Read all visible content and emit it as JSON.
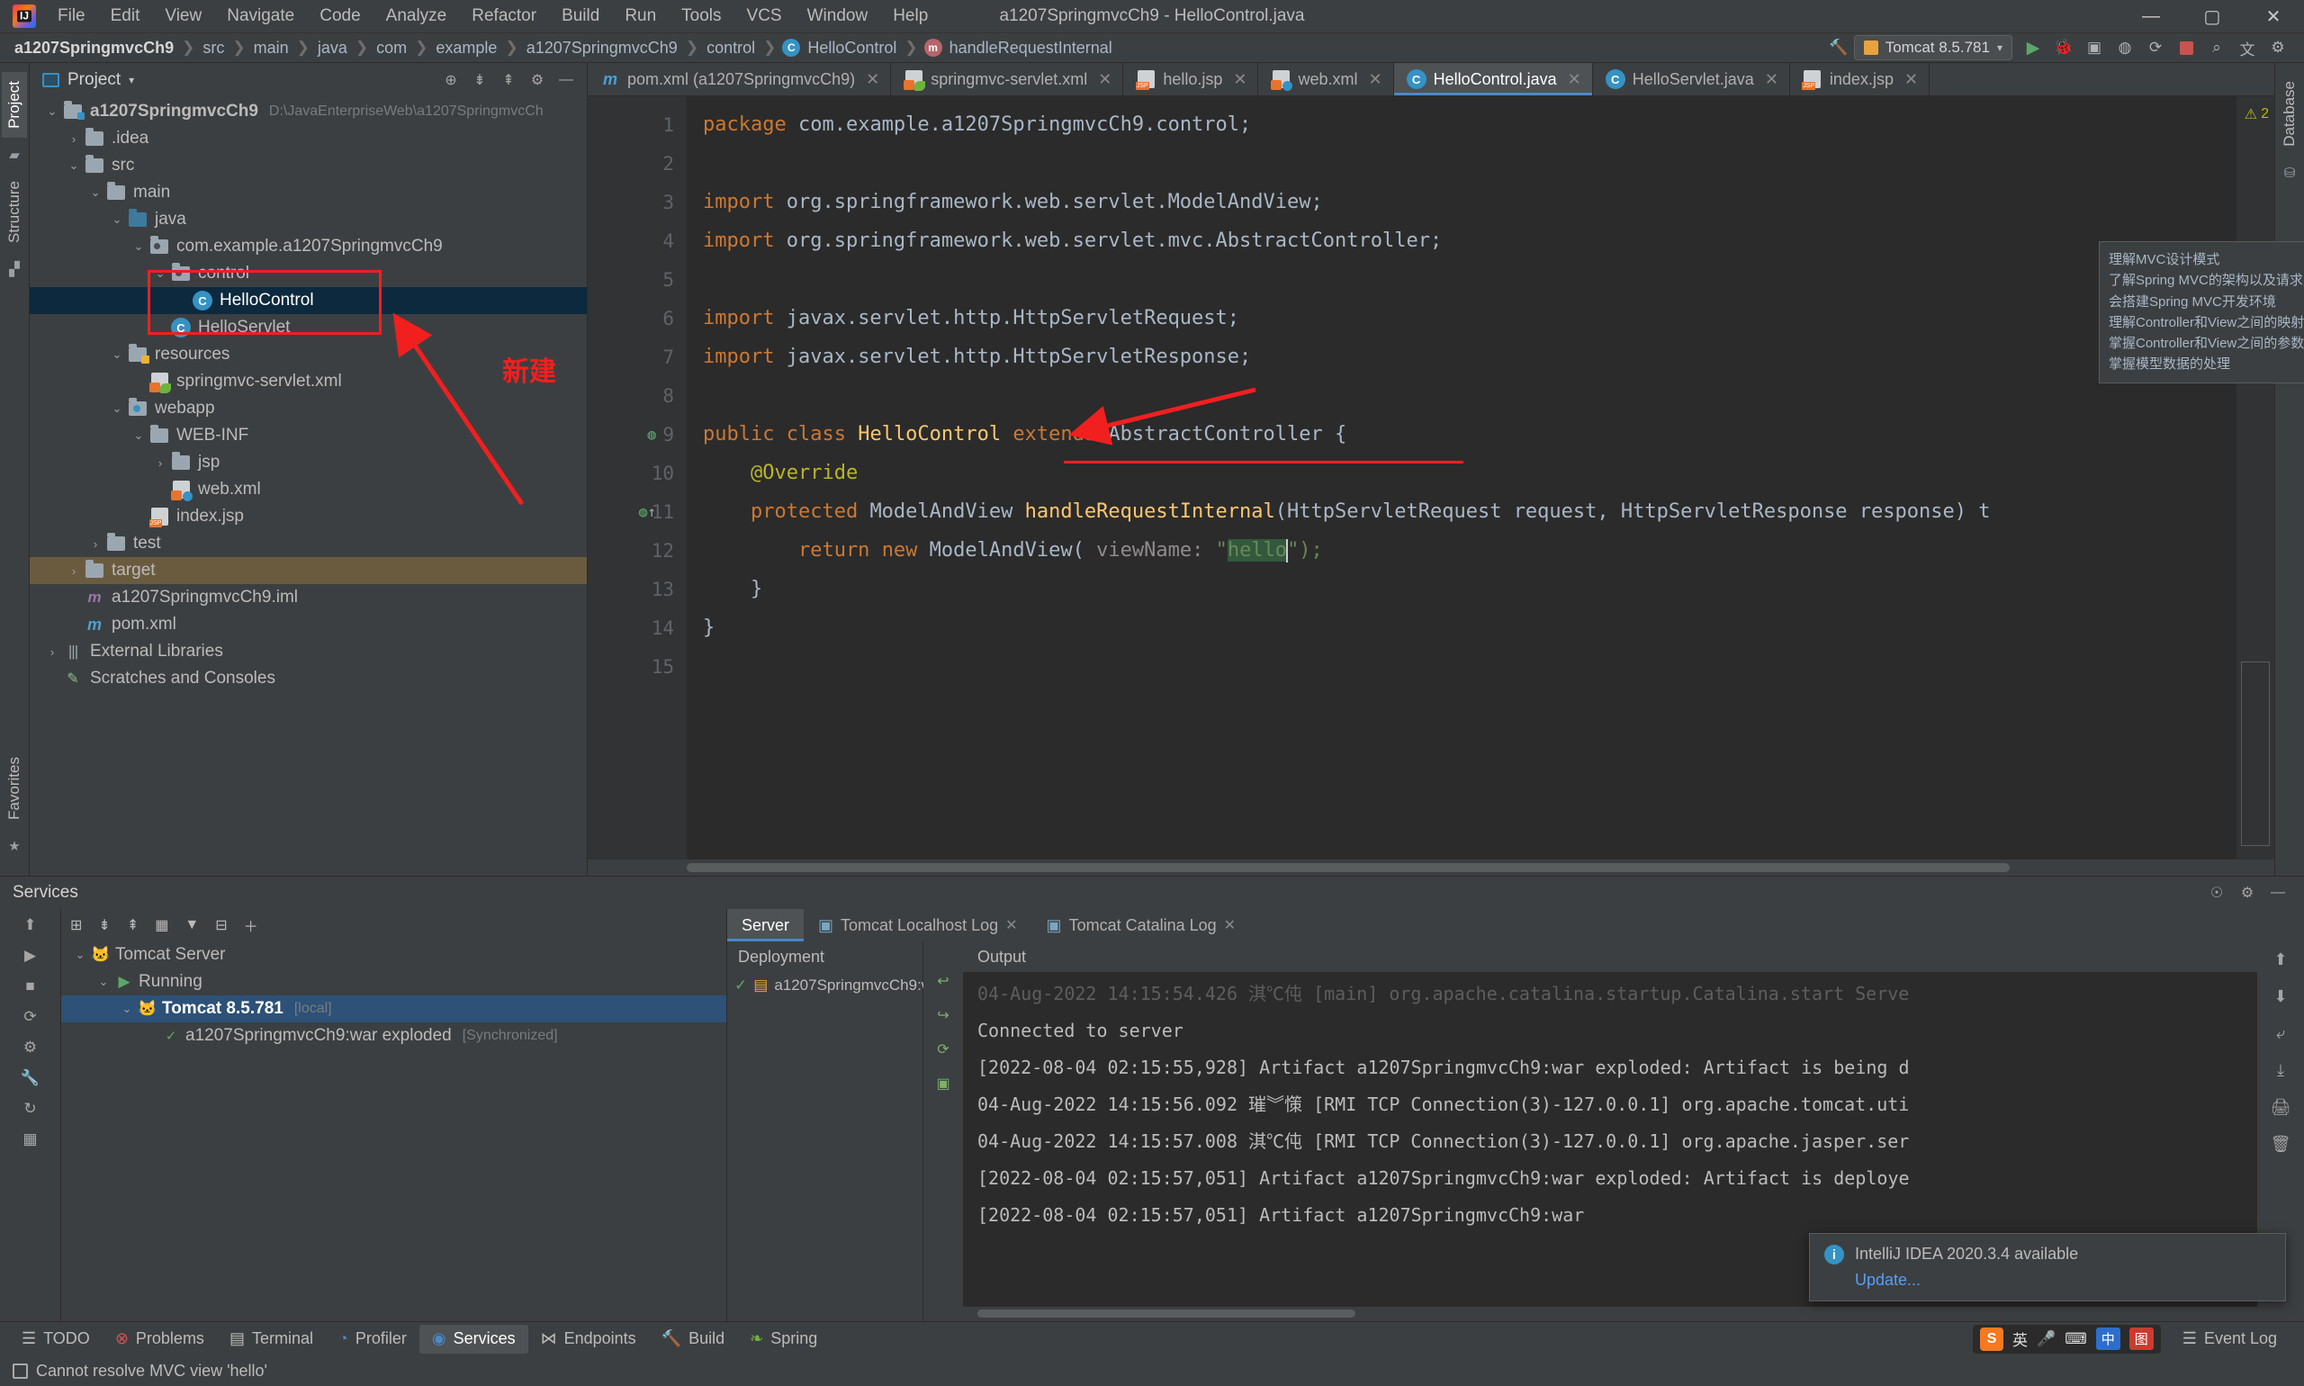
{
  "window": {
    "title": "a1207SpringmvcCh9 - HelloControl.java",
    "minimize": "—",
    "maximize": "▢",
    "close": "✕"
  },
  "menu": [
    "File",
    "Edit",
    "View",
    "Navigate",
    "Code",
    "Analyze",
    "Refactor",
    "Build",
    "Run",
    "Tools",
    "VCS",
    "Window",
    "Help"
  ],
  "breadcrumb": [
    {
      "label": "a1207SpringmvcCh9",
      "bold": true,
      "icon": ""
    },
    {
      "label": "src",
      "bold": false,
      "icon": ""
    },
    {
      "label": "main",
      "bold": false,
      "icon": ""
    },
    {
      "label": "java",
      "bold": false,
      "icon": ""
    },
    {
      "label": "com",
      "bold": false,
      "icon": ""
    },
    {
      "label": "example",
      "bold": false,
      "icon": ""
    },
    {
      "label": "a1207SpringmvcCh9",
      "bold": false,
      "icon": ""
    },
    {
      "label": "control",
      "bold": false,
      "icon": ""
    },
    {
      "label": "HelloControl",
      "bold": false,
      "icon": "class-icon"
    },
    {
      "label": "handleRequestInternal",
      "bold": false,
      "icon": "method-icon"
    }
  ],
  "toolbar": {
    "run_config": "Tomcat 8.5.781",
    "search_icon": "🔍",
    "run_icon": "▶",
    "debug_icon": "🐞",
    "stop_icon": "■",
    "build_icon": "🔨",
    "settings_icon": "⚙",
    "translate_icon": "文",
    "dropdown_icon": "▾"
  },
  "left_rail": {
    "project_tab": "Project",
    "structure_tab": "Structure",
    "favorites_tab": "Favorites"
  },
  "right_rail": {
    "database_tab": "Database"
  },
  "project_panel": {
    "title": "Project",
    "tree": [
      {
        "indent": 0,
        "arrow": "v",
        "icon": "project-folder-icon",
        "label": "a1207SpringmvcCh9",
        "sub": "D:\\JavaEnterpriseWeb\\a1207SpringmvcCh",
        "bold": true
      },
      {
        "indent": 1,
        "arrow": ">",
        "icon": "folder-icon",
        "label": ".idea",
        "sub": "",
        "bold": false
      },
      {
        "indent": 1,
        "arrow": "v",
        "icon": "folder-icon",
        "label": "src",
        "sub": "",
        "bold": false
      },
      {
        "indent": 2,
        "arrow": "v",
        "icon": "folder-icon",
        "label": "main",
        "sub": "",
        "bold": false
      },
      {
        "indent": 3,
        "arrow": "v",
        "icon": "source-folder-icon",
        "label": "java",
        "sub": "",
        "bold": false
      },
      {
        "indent": 4,
        "arrow": "v",
        "icon": "package-icon",
        "label": "com.example.a1207SpringmvcCh9",
        "sub": "",
        "bold": false
      },
      {
        "indent": 5,
        "arrow": "v",
        "icon": "package-icon",
        "label": "control",
        "sub": "",
        "bold": false
      },
      {
        "indent": 6,
        "arrow": "",
        "icon": "class-icon",
        "label": "HelloControl",
        "sub": "",
        "bold": false,
        "selected": true
      },
      {
        "indent": 5,
        "arrow": "",
        "icon": "class-icon",
        "label": "HelloServlet",
        "sub": "",
        "bold": false
      },
      {
        "indent": 3,
        "arrow": "v",
        "icon": "resources-folder-icon",
        "label": "resources",
        "sub": "",
        "bold": false
      },
      {
        "indent": 4,
        "arrow": "",
        "icon": "spring-xml-icon",
        "label": "springmvc-servlet.xml",
        "sub": "",
        "bold": false
      },
      {
        "indent": 3,
        "arrow": "v",
        "icon": "web-folder-icon",
        "label": "webapp",
        "sub": "",
        "bold": false
      },
      {
        "indent": 4,
        "arrow": "v",
        "icon": "folder-icon",
        "label": "WEB-INF",
        "sub": "",
        "bold": false
      },
      {
        "indent": 5,
        "arrow": ">",
        "icon": "folder-icon",
        "label": "jsp",
        "sub": "",
        "bold": false
      },
      {
        "indent": 5,
        "arrow": "",
        "icon": "web-xml-icon",
        "label": "web.xml",
        "sub": "",
        "bold": false
      },
      {
        "indent": 4,
        "arrow": "",
        "icon": "jsp-icon",
        "label": "index.jsp",
        "sub": "",
        "bold": false
      },
      {
        "indent": 2,
        "arrow": ">",
        "icon": "folder-icon",
        "label": "test",
        "sub": "",
        "bold": false
      },
      {
        "indent": 1,
        "arrow": ">",
        "icon": "folder-icon",
        "label": "target",
        "sub": "",
        "bold": false,
        "target": true
      },
      {
        "indent": 1,
        "arrow": "",
        "icon": "iml-icon",
        "label": "a1207SpringmvcCh9.iml",
        "sub": "",
        "bold": false
      },
      {
        "indent": 1,
        "arrow": "",
        "icon": "maven-icon",
        "label": "pom.xml",
        "sub": "",
        "bold": false
      },
      {
        "indent": 0,
        "arrow": ">",
        "icon": "library-icon",
        "label": "External Libraries",
        "sub": "",
        "bold": false
      },
      {
        "indent": 0,
        "arrow": "",
        "icon": "scratches-icon",
        "label": "Scratches and Consoles",
        "sub": "",
        "bold": false
      }
    ],
    "annotation_label": "新建"
  },
  "editor": {
    "tabs": [
      {
        "label": "pom.xml (a1207SpringmvcCh9)",
        "icon": "maven-icon",
        "active": false
      },
      {
        "label": "springmvc-servlet.xml",
        "icon": "spring-xml-icon",
        "active": false
      },
      {
        "label": "hello.jsp",
        "icon": "jsp-icon",
        "active": false
      },
      {
        "label": "web.xml",
        "icon": "web-xml-icon",
        "active": false
      },
      {
        "label": "HelloControl.java",
        "icon": "class-icon",
        "active": true
      },
      {
        "label": "HelloServlet.java",
        "icon": "class-icon",
        "active": false
      },
      {
        "label": "index.jsp",
        "icon": "jsp-icon",
        "active": false
      }
    ],
    "warning_count": "2",
    "line_numbers": [
      "1",
      "2",
      "3",
      "4",
      "5",
      "6",
      "7",
      "8",
      "9",
      "10",
      "11",
      "12",
      "13",
      "14",
      "15"
    ],
    "code_lines": [
      {
        "n": 1,
        "tokens": [
          {
            "t": "package ",
            "c": "kw"
          },
          {
            "t": "com.example.a1207SpringmvcCh9.control;",
            "c": "plain"
          }
        ]
      },
      {
        "n": 2,
        "tokens": []
      },
      {
        "n": 3,
        "fold": "−",
        "tokens": [
          {
            "t": "import ",
            "c": "kw"
          },
          {
            "t": "org.springframework.web.servlet.ModelAndView;",
            "c": "plain"
          }
        ]
      },
      {
        "n": 4,
        "tokens": [
          {
            "t": "import ",
            "c": "kw"
          },
          {
            "t": "org.springframework.web.servlet.mvc.AbstractController;",
            "c": "plain"
          }
        ]
      },
      {
        "n": 5,
        "tokens": []
      },
      {
        "n": 6,
        "tokens": [
          {
            "t": "import ",
            "c": "kw"
          },
          {
            "t": "javax.servlet.http.HttpServletRequest;",
            "c": "plain"
          }
        ]
      },
      {
        "n": 7,
        "fold": "−",
        "tokens": [
          {
            "t": "import ",
            "c": "kw"
          },
          {
            "t": "javax.servlet.http.HttpServletResponse;",
            "c": "plain"
          }
        ]
      },
      {
        "n": 8,
        "tokens": []
      },
      {
        "n": 9,
        "tokens": [
          {
            "t": "public ",
            "c": "kw"
          },
          {
            "t": "class ",
            "c": "kw"
          },
          {
            "t": "HelloControl ",
            "c": "ident"
          },
          {
            "t": "extends ",
            "c": "kw"
          },
          {
            "t": "AbstractController ",
            "c": "plain"
          },
          {
            "t": "{",
            "c": "plain"
          }
        ]
      },
      {
        "n": 10,
        "tokens": [
          {
            "t": "    @Override",
            "c": "ann"
          }
        ]
      },
      {
        "n": 11,
        "tokens": [
          {
            "t": "    protected ",
            "c": "kw"
          },
          {
            "t": "ModelAndView ",
            "c": "plain"
          },
          {
            "t": "handleRequestInternal",
            "c": "ident"
          },
          {
            "t": "(HttpServletRequest ",
            "c": "plain"
          },
          {
            "t": "request",
            "c": "plain"
          },
          {
            "t": ", HttpServletResponse ",
            "c": "plain"
          },
          {
            "t": "response",
            "c": "plain"
          },
          {
            "t": ") t",
            "c": "plain"
          }
        ]
      },
      {
        "n": 12,
        "tokens": [
          {
            "t": "        return ",
            "c": "kw"
          },
          {
            "t": "new ",
            "c": "kw"
          },
          {
            "t": "ModelAndView( ",
            "c": "plain"
          },
          {
            "t": "viewName:",
            "c": "param"
          },
          {
            "t": " \"",
            "c": "str"
          },
          {
            "t": "hello",
            "c": "str-sel"
          },
          {
            "t": "\");",
            "c": "str"
          }
        ]
      },
      {
        "n": 13,
        "fold": "−",
        "tokens": [
          {
            "t": "    }",
            "c": "plain"
          }
        ]
      },
      {
        "n": 14,
        "tokens": [
          {
            "t": "}",
            "c": "plain"
          }
        ]
      },
      {
        "n": 15,
        "tokens": []
      }
    ],
    "help_overlay": [
      "理解MVC设计模式",
      "了解Spring MVC的架构以及请求处理流程",
      "会搭建Spring MVC开发环境",
      "理解Controller和View之间的映射关系",
      "掌握Controller和View之间的参数传递",
      "掌握模型数据的处理"
    ]
  },
  "services": {
    "title": "Services",
    "tree": [
      {
        "indent": 0,
        "arrow": "v",
        "icon": "tomcat-icon",
        "label": "Tomcat Server",
        "sub": "",
        "bold": false
      },
      {
        "indent": 1,
        "arrow": "v",
        "icon": "run-icon",
        "label": "Running",
        "sub": "",
        "bold": false
      },
      {
        "indent": 2,
        "arrow": "v",
        "icon": "tomcat-icon",
        "label": "Tomcat 8.5.781",
        "sub": "[local]",
        "bold": true,
        "selected": true
      },
      {
        "indent": 3,
        "arrow": "",
        "icon": "artifact-icon",
        "label": "a1207SpringmvcCh9:war exploded",
        "sub": "[Synchronized]",
        "bold": false
      }
    ],
    "console_tabs": [
      {
        "label": "Server",
        "active": true,
        "closable": false
      },
      {
        "label": "Tomcat Localhost Log",
        "active": false,
        "closable": true
      },
      {
        "label": "Tomcat Catalina Log",
        "active": false,
        "closable": true
      }
    ],
    "deployment_header": "Deployment",
    "deployment_rows": [
      {
        "label": "a1207SpringmvcCh9:w",
        "status": "ok"
      }
    ],
    "output_header": "Output",
    "output_lines": [
      "04-Aug-2022 14:15:54.426 淇℃伅 [main] org.apache.catalina.startup.Catalina.start Serve",
      "Connected to server",
      "[2022-08-04 02:15:55,928] Artifact a1207SpringmvcCh9:war exploded: Artifact is being d",
      "04-Aug-2022 14:15:56.092 璀︾憡 [RMI TCP Connection(3)-127.0.0.1] org.apache.tomcat.uti",
      "04-Aug-2022 14:15:57.008 淇℃伅 [RMI TCP Connection(3)-127.0.0.1] org.apache.jasper.ser",
      "[2022-08-04 02:15:57,051] Artifact a1207SpringmvcCh9:war exploded: Artifact is deploye",
      "[2022-08-04 02:15:57,051] Artifact a1207SpringmvcCh9:war"
    ]
  },
  "notification": {
    "title": "IntelliJ IDEA 2020.3.4 available",
    "link": "Update..."
  },
  "statusbar": {
    "items": [
      {
        "label": "TODO",
        "icon": "todo-icon",
        "active": false
      },
      {
        "label": "Problems",
        "icon": "problems-icon",
        "active": false
      },
      {
        "label": "Terminal",
        "icon": "terminal-icon",
        "active": false
      },
      {
        "label": "Profiler",
        "icon": "profiler-icon",
        "active": false
      },
      {
        "label": "Services",
        "icon": "services-icon",
        "active": true
      },
      {
        "label": "Endpoints",
        "icon": "endpoints-icon",
        "active": false
      },
      {
        "label": "Build",
        "icon": "build-icon",
        "active": false
      },
      {
        "label": "Spring",
        "icon": "spring-icon",
        "active": false
      }
    ],
    "event_log": "Event Log",
    "error_message": "Cannot resolve MVC view 'hello'",
    "ime": {
      "lang": "英",
      "mic": "🎤",
      "keyboard": "⌨",
      "logo": "S"
    }
  },
  "colors": {
    "accent": "#4a88c7",
    "annotation_red": "#f21f1f",
    "selection_blue": "#0d293e",
    "keyword_orange": "#cc7832",
    "string_green": "#6a8759",
    "panel_bg": "#3c3f41",
    "editor_bg": "#2b2b2b"
  }
}
